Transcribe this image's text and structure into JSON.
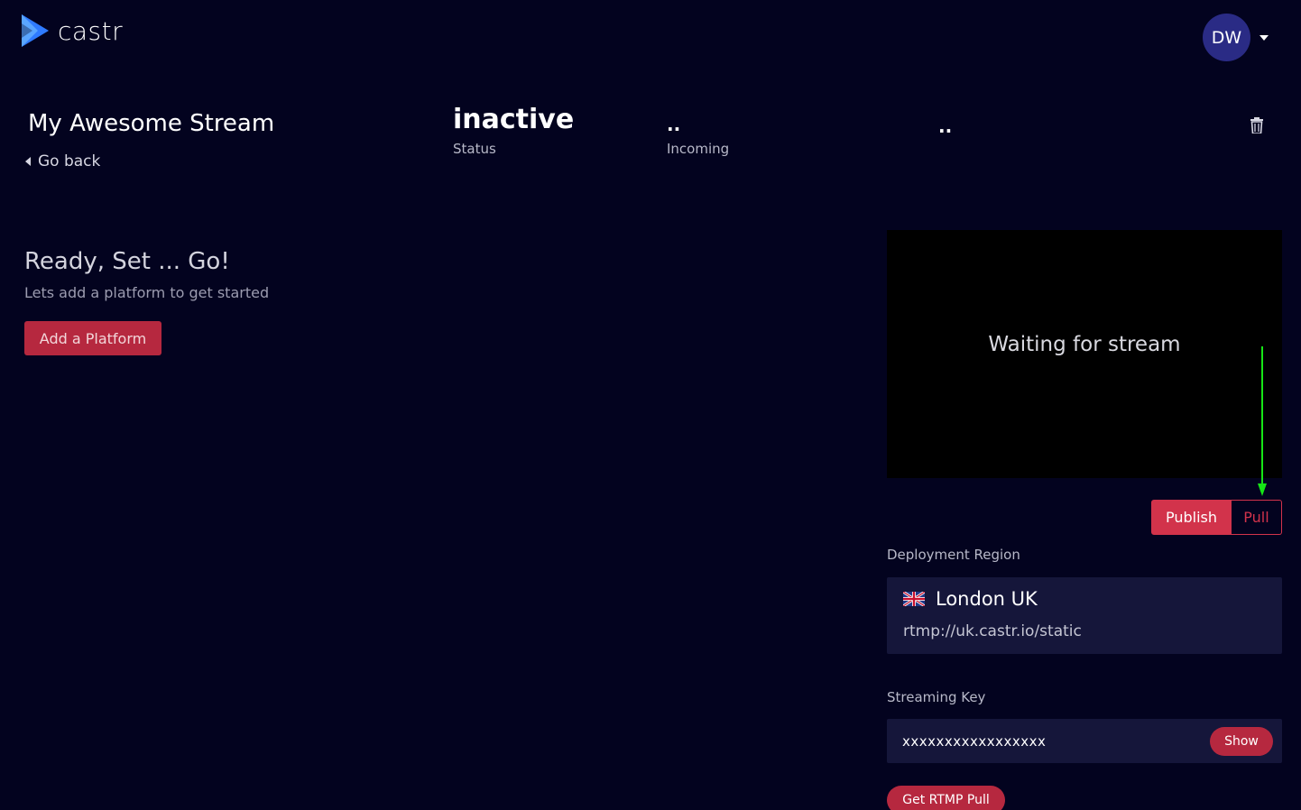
{
  "app": {
    "brand": "castr",
    "accent_color": "#d2334b"
  },
  "user": {
    "initials": "DW"
  },
  "stream": {
    "title": "My Awesome Stream",
    "go_back": "Go back",
    "status_value": "inactive",
    "status_label": "Status",
    "incoming_value": "..",
    "incoming_label": "Incoming",
    "other_value": ".."
  },
  "empty_state": {
    "title": "Ready, Set ...  Go!",
    "subtitle": "Lets add a platform to get started",
    "button": "Add a Platform"
  },
  "player": {
    "message": "Waiting for stream"
  },
  "mode": {
    "publish": "Publish",
    "pull": "Pull",
    "selected": "Publish"
  },
  "region": {
    "label": "Deployment Region",
    "name": "London UK",
    "url": "rtmp://uk.castr.io/static"
  },
  "key": {
    "label": "Streaming Key",
    "value": "xxxxxxxxxxxxxxxxx",
    "show": "Show"
  },
  "rtmp_pull_button": "Get RTMP Pull"
}
